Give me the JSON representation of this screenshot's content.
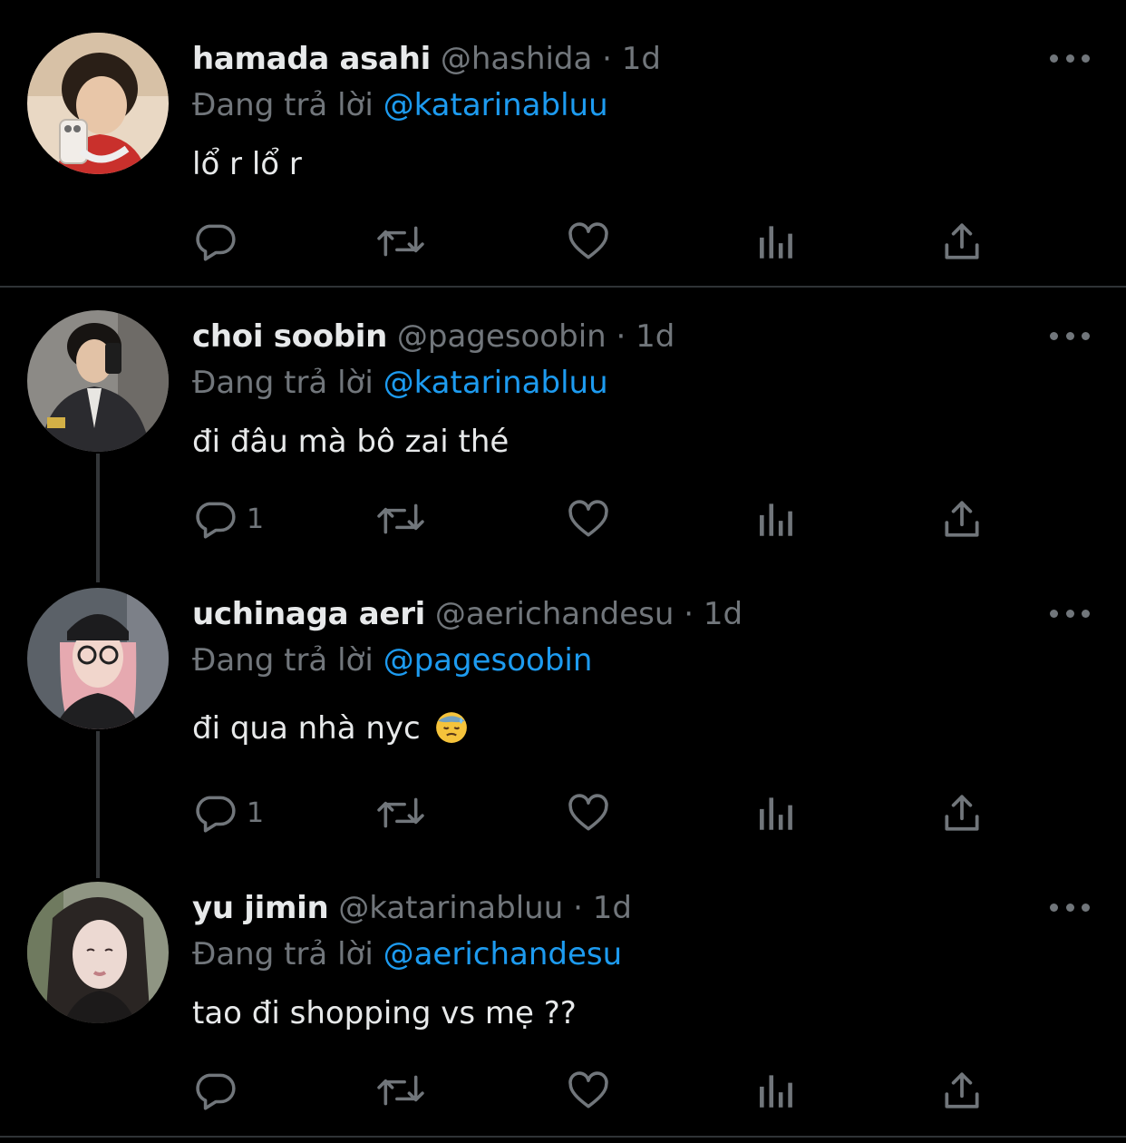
{
  "reply_prefix": "Đang trả lời",
  "dot": "·",
  "tweets": [
    {
      "name": "hamada asahi",
      "handle": "@hashida",
      "time": "1d",
      "reply_to": "@katarinabluu",
      "text": "lổ r lổ r",
      "reply_count": "",
      "avatar_icon": "avatar-photo"
    },
    {
      "name": "choi soobin",
      "handle": "@pagesoobin",
      "time": "1d",
      "reply_to": "@katarinabluu",
      "text": "đi đâu mà bô zai thé",
      "reply_count": "1",
      "avatar_icon": "avatar-photo"
    },
    {
      "name": "uchinaga aeri",
      "handle": "@aerichandesu",
      "time": "1d",
      "reply_to": "@pagesoobin",
      "text": "đi qua nhà nyc",
      "emoji": "downcast-sweat-face",
      "reply_count": "1",
      "avatar_icon": "avatar-photo"
    },
    {
      "name": "yu jimin",
      "handle": "@katarinabluu",
      "time": "1d",
      "reply_to": "@aerichandesu",
      "text": "tao đi shopping vs mẹ ??",
      "reply_count": "",
      "avatar_icon": "avatar-photo"
    }
  ],
  "icons": [
    "reply-icon",
    "retweet-icon",
    "like-icon",
    "views-icon",
    "share-icon",
    "more-icon"
  ],
  "colors": {
    "background": "#000000",
    "text": "#e7e9ea",
    "secondary": "#71767b",
    "mention": "#1d9bf0",
    "divider": "#2f3336"
  }
}
